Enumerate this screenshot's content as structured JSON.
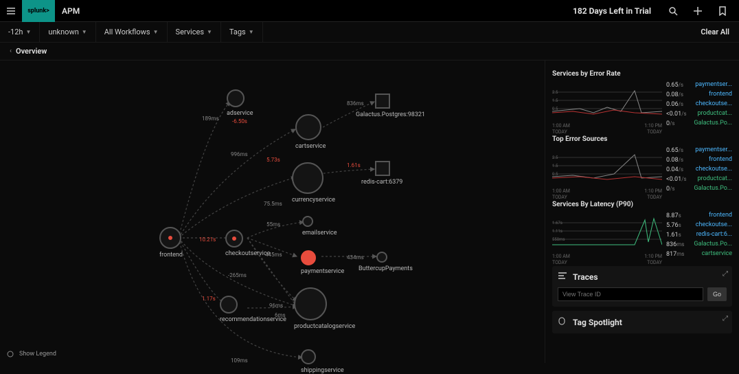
{
  "header": {
    "app_title": "APM",
    "logo_text": "splunk>",
    "trial_text": "182 Days Left in Trial"
  },
  "filters": {
    "time": "-12h",
    "env": "unknown",
    "workflows": "All Workflows",
    "services": "Services",
    "tags": "Tags",
    "clear": "Clear All"
  },
  "subheader": {
    "overview": "Overview"
  },
  "legend": {
    "show": "Show Legend"
  },
  "map": {
    "nodes": {
      "frontend": "frontend",
      "adservice": "adservice",
      "cartservice": "cartservice",
      "currencyservice": "currencyservice",
      "emailservice": "emailservice",
      "checkoutservice": "checkoutservice",
      "paymentservice": "paymentservice",
      "recommendationservice": "recommendationservice",
      "productcatalogservice": "productcatalogservice",
      "shippingservice": "shippingservice",
      "galactus": "Galactus.Postgres:98321",
      "redis": "redis-cart:6379",
      "buttercup": "ButtercupPayments"
    },
    "edge_labels": {
      "e1": "189ms",
      "e2": "-6.50s",
      "e3": "836ms",
      "e4": "996ms",
      "e5": "5.73s",
      "e6": "75.5ms",
      "e7": "1.61s",
      "e8": "55ms",
      "e9": "10.21s",
      "e10": "445ms",
      "e11": "434ms",
      "e12": "-265ms",
      "e13": "1.17s",
      "e14": "96ms",
      "e15": "6ms",
      "e16": "109ms"
    }
  },
  "side": {
    "panel1": {
      "title": "Services by Error Rate",
      "rows": [
        {
          "val": "0.65",
          "unit": "/s",
          "name": "paymentser...",
          "cls": ""
        },
        {
          "val": "0.08",
          "unit": "/s",
          "name": "frontend",
          "cls": ""
        },
        {
          "val": "0.06",
          "unit": "/s",
          "name": "checkoutse...",
          "cls": ""
        },
        {
          "val": "<0.01",
          "unit": "/s",
          "name": "productcat...",
          "cls": "green"
        },
        {
          "val": "0",
          "unit": "/s",
          "name": "Galactus.Po...",
          "cls": "green"
        }
      ],
      "xlabels": [
        "1:00 AM",
        "1:10 PM"
      ],
      "xsub": "TODAY"
    },
    "panel2": {
      "title": "Top Error Sources",
      "rows": [
        {
          "val": "0.65",
          "unit": "/s",
          "name": "paymentser...",
          "cls": ""
        },
        {
          "val": "0.08",
          "unit": "/s",
          "name": "frontend",
          "cls": ""
        },
        {
          "val": "0.04",
          "unit": "/s",
          "name": "checkoutse...",
          "cls": ""
        },
        {
          "val": "<0.01",
          "unit": "/s",
          "name": "productcat...",
          "cls": "green"
        },
        {
          "val": "0",
          "unit": "/s",
          "name": "Galactus.Po...",
          "cls": "green"
        }
      ],
      "xlabels": [
        "1:00 AM",
        "1:10 PM"
      ],
      "xsub": "TODAY"
    },
    "panel3": {
      "title": "Services By Latency (P90)",
      "rows": [
        {
          "val": "8.87",
          "unit": "s",
          "name": "frontend",
          "cls": ""
        },
        {
          "val": "5.76",
          "unit": "s",
          "name": "checkoutse...",
          "cls": ""
        },
        {
          "val": "1.61",
          "unit": "s",
          "name": "redis-cart:6...",
          "cls": ""
        },
        {
          "val": "836",
          "unit": "ms",
          "name": "Galactus.Po...",
          "cls": "green"
        },
        {
          "val": "817",
          "unit": "ms",
          "name": "cartservice",
          "cls": "green"
        }
      ],
      "xlabels": [
        "1:00 AM",
        "1:10 PM"
      ],
      "xsub": "TODAY"
    },
    "traces": {
      "title": "Traces",
      "placeholder": "View Trace ID",
      "go": "Go"
    },
    "tagspot": {
      "title": "Tag Spotlight"
    }
  },
  "chart_data": [
    {
      "type": "line",
      "title": "Services by Error Rate",
      "x_range": [
        "1:00 AM",
        "1:10 PM"
      ],
      "ylim": [
        0,
        3
      ],
      "yticks": [
        0.5,
        1.5,
        2.5
      ],
      "series": [
        {
          "name": "paymentservice",
          "value_per_s": 0.65
        },
        {
          "name": "frontend",
          "value_per_s": 0.08
        },
        {
          "name": "checkoutservice",
          "value_per_s": 0.06
        },
        {
          "name": "productcatalogservice",
          "value_per_s": 0.005
        },
        {
          "name": "Galactus.Postgres",
          "value_per_s": 0
        }
      ]
    },
    {
      "type": "line",
      "title": "Top Error Sources",
      "x_range": [
        "1:00 AM",
        "1:10 PM"
      ],
      "ylim": [
        0,
        3
      ],
      "yticks": [
        0.5,
        1.5,
        2.5
      ],
      "series": [
        {
          "name": "paymentservice",
          "value_per_s": 0.65
        },
        {
          "name": "frontend",
          "value_per_s": 0.08
        },
        {
          "name": "checkoutservice",
          "value_per_s": 0.04
        },
        {
          "name": "productcatalogservice",
          "value_per_s": 0.005
        },
        {
          "name": "Galactus.Postgres",
          "value_per_s": 0
        }
      ]
    },
    {
      "type": "line",
      "title": "Services By Latency (P90)",
      "x_range": [
        "1:00 AM",
        "1:10 PM"
      ],
      "ylim": [
        0,
        2
      ],
      "yticks": [
        "550ms",
        "1.11s",
        "1.67s"
      ],
      "series": [
        {
          "name": "frontend",
          "latency": "8.87s"
        },
        {
          "name": "checkoutservice",
          "latency": "5.76s"
        },
        {
          "name": "redis-cart:6379",
          "latency": "1.61s"
        },
        {
          "name": "Galactus.Postgres",
          "latency": "836ms"
        },
        {
          "name": "cartservice",
          "latency": "817ms"
        }
      ]
    }
  ]
}
